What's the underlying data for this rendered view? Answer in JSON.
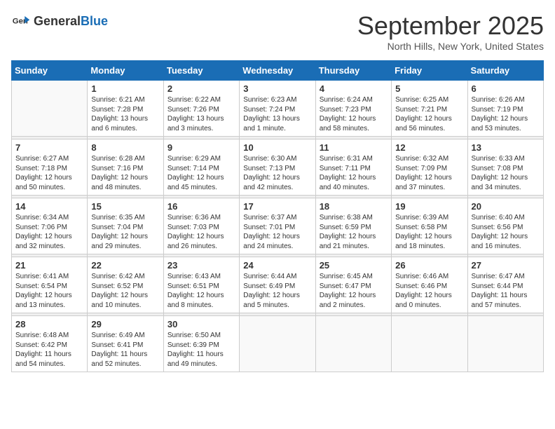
{
  "header": {
    "logo_general": "General",
    "logo_blue": "Blue",
    "month_title": "September 2025",
    "location": "North Hills, New York, United States"
  },
  "weekdays": [
    "Sunday",
    "Monday",
    "Tuesday",
    "Wednesday",
    "Thursday",
    "Friday",
    "Saturday"
  ],
  "weeks": [
    [
      {
        "day": "",
        "sunrise": "",
        "sunset": "",
        "daylight": ""
      },
      {
        "day": "1",
        "sunrise": "Sunrise: 6:21 AM",
        "sunset": "Sunset: 7:28 PM",
        "daylight": "Daylight: 13 hours and 6 minutes."
      },
      {
        "day": "2",
        "sunrise": "Sunrise: 6:22 AM",
        "sunset": "Sunset: 7:26 PM",
        "daylight": "Daylight: 13 hours and 3 minutes."
      },
      {
        "day": "3",
        "sunrise": "Sunrise: 6:23 AM",
        "sunset": "Sunset: 7:24 PM",
        "daylight": "Daylight: 13 hours and 1 minute."
      },
      {
        "day": "4",
        "sunrise": "Sunrise: 6:24 AM",
        "sunset": "Sunset: 7:23 PM",
        "daylight": "Daylight: 12 hours and 58 minutes."
      },
      {
        "day": "5",
        "sunrise": "Sunrise: 6:25 AM",
        "sunset": "Sunset: 7:21 PM",
        "daylight": "Daylight: 12 hours and 56 minutes."
      },
      {
        "day": "6",
        "sunrise": "Sunrise: 6:26 AM",
        "sunset": "Sunset: 7:19 PM",
        "daylight": "Daylight: 12 hours and 53 minutes."
      }
    ],
    [
      {
        "day": "7",
        "sunrise": "Sunrise: 6:27 AM",
        "sunset": "Sunset: 7:18 PM",
        "daylight": "Daylight: 12 hours and 50 minutes."
      },
      {
        "day": "8",
        "sunrise": "Sunrise: 6:28 AM",
        "sunset": "Sunset: 7:16 PM",
        "daylight": "Daylight: 12 hours and 48 minutes."
      },
      {
        "day": "9",
        "sunrise": "Sunrise: 6:29 AM",
        "sunset": "Sunset: 7:14 PM",
        "daylight": "Daylight: 12 hours and 45 minutes."
      },
      {
        "day": "10",
        "sunrise": "Sunrise: 6:30 AM",
        "sunset": "Sunset: 7:13 PM",
        "daylight": "Daylight: 12 hours and 42 minutes."
      },
      {
        "day": "11",
        "sunrise": "Sunrise: 6:31 AM",
        "sunset": "Sunset: 7:11 PM",
        "daylight": "Daylight: 12 hours and 40 minutes."
      },
      {
        "day": "12",
        "sunrise": "Sunrise: 6:32 AM",
        "sunset": "Sunset: 7:09 PM",
        "daylight": "Daylight: 12 hours and 37 minutes."
      },
      {
        "day": "13",
        "sunrise": "Sunrise: 6:33 AM",
        "sunset": "Sunset: 7:08 PM",
        "daylight": "Daylight: 12 hours and 34 minutes."
      }
    ],
    [
      {
        "day": "14",
        "sunrise": "Sunrise: 6:34 AM",
        "sunset": "Sunset: 7:06 PM",
        "daylight": "Daylight: 12 hours and 32 minutes."
      },
      {
        "day": "15",
        "sunrise": "Sunrise: 6:35 AM",
        "sunset": "Sunset: 7:04 PM",
        "daylight": "Daylight: 12 hours and 29 minutes."
      },
      {
        "day": "16",
        "sunrise": "Sunrise: 6:36 AM",
        "sunset": "Sunset: 7:03 PM",
        "daylight": "Daylight: 12 hours and 26 minutes."
      },
      {
        "day": "17",
        "sunrise": "Sunrise: 6:37 AM",
        "sunset": "Sunset: 7:01 PM",
        "daylight": "Daylight: 12 hours and 24 minutes."
      },
      {
        "day": "18",
        "sunrise": "Sunrise: 6:38 AM",
        "sunset": "Sunset: 6:59 PM",
        "daylight": "Daylight: 12 hours and 21 minutes."
      },
      {
        "day": "19",
        "sunrise": "Sunrise: 6:39 AM",
        "sunset": "Sunset: 6:58 PM",
        "daylight": "Daylight: 12 hours and 18 minutes."
      },
      {
        "day": "20",
        "sunrise": "Sunrise: 6:40 AM",
        "sunset": "Sunset: 6:56 PM",
        "daylight": "Daylight: 12 hours and 16 minutes."
      }
    ],
    [
      {
        "day": "21",
        "sunrise": "Sunrise: 6:41 AM",
        "sunset": "Sunset: 6:54 PM",
        "daylight": "Daylight: 12 hours and 13 minutes."
      },
      {
        "day": "22",
        "sunrise": "Sunrise: 6:42 AM",
        "sunset": "Sunset: 6:52 PM",
        "daylight": "Daylight: 12 hours and 10 minutes."
      },
      {
        "day": "23",
        "sunrise": "Sunrise: 6:43 AM",
        "sunset": "Sunset: 6:51 PM",
        "daylight": "Daylight: 12 hours and 8 minutes."
      },
      {
        "day": "24",
        "sunrise": "Sunrise: 6:44 AM",
        "sunset": "Sunset: 6:49 PM",
        "daylight": "Daylight: 12 hours and 5 minutes."
      },
      {
        "day": "25",
        "sunrise": "Sunrise: 6:45 AM",
        "sunset": "Sunset: 6:47 PM",
        "daylight": "Daylight: 12 hours and 2 minutes."
      },
      {
        "day": "26",
        "sunrise": "Sunrise: 6:46 AM",
        "sunset": "Sunset: 6:46 PM",
        "daylight": "Daylight: 12 hours and 0 minutes."
      },
      {
        "day": "27",
        "sunrise": "Sunrise: 6:47 AM",
        "sunset": "Sunset: 6:44 PM",
        "daylight": "Daylight: 11 hours and 57 minutes."
      }
    ],
    [
      {
        "day": "28",
        "sunrise": "Sunrise: 6:48 AM",
        "sunset": "Sunset: 6:42 PM",
        "daylight": "Daylight: 11 hours and 54 minutes."
      },
      {
        "day": "29",
        "sunrise": "Sunrise: 6:49 AM",
        "sunset": "Sunset: 6:41 PM",
        "daylight": "Daylight: 11 hours and 52 minutes."
      },
      {
        "day": "30",
        "sunrise": "Sunrise: 6:50 AM",
        "sunset": "Sunset: 6:39 PM",
        "daylight": "Daylight: 11 hours and 49 minutes."
      },
      {
        "day": "",
        "sunrise": "",
        "sunset": "",
        "daylight": ""
      },
      {
        "day": "",
        "sunrise": "",
        "sunset": "",
        "daylight": ""
      },
      {
        "day": "",
        "sunrise": "",
        "sunset": "",
        "daylight": ""
      },
      {
        "day": "",
        "sunrise": "",
        "sunset": "",
        "daylight": ""
      }
    ]
  ]
}
